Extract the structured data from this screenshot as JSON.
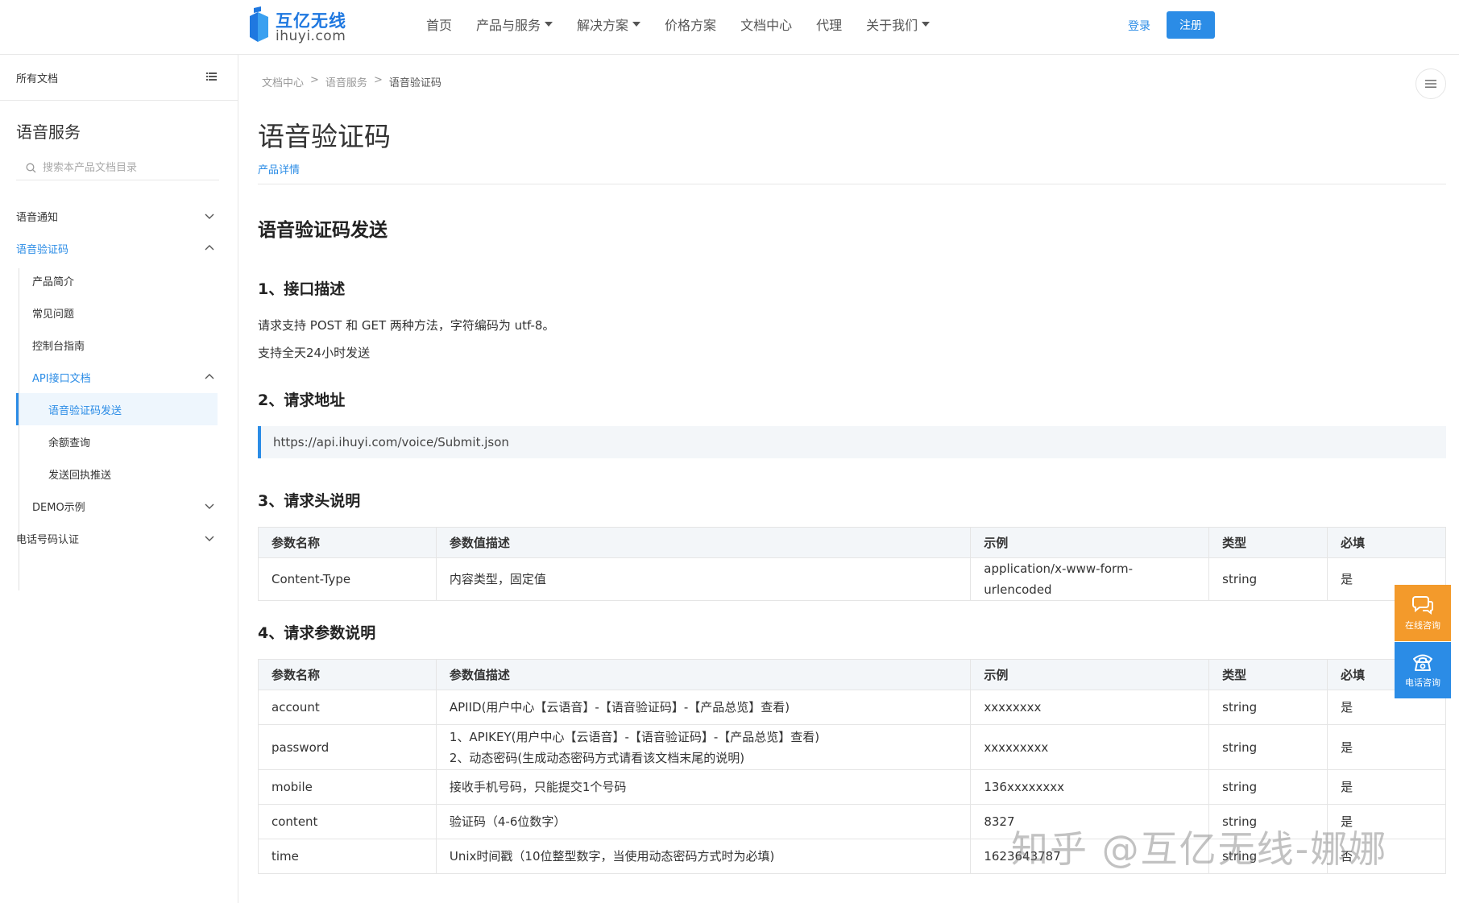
{
  "header": {
    "brand_cn": "互亿无线",
    "brand_en": "ihuyi.com",
    "nav": [
      {
        "label": "首页",
        "dropdown": false
      },
      {
        "label": "产品与服务",
        "dropdown": true
      },
      {
        "label": "解决方案",
        "dropdown": true
      },
      {
        "label": "价格方案",
        "dropdown": false
      },
      {
        "label": "文档中心",
        "dropdown": false
      },
      {
        "label": "代理",
        "dropdown": false
      },
      {
        "label": "关于我们",
        "dropdown": true
      }
    ],
    "login": "登录",
    "register": "注册"
  },
  "sidebar": {
    "all_docs": "所有文档",
    "title": "语音服务",
    "search_placeholder": "搜索本产品文档目录",
    "items": [
      {
        "label": "语音通知",
        "level": 0,
        "state": "collapsed"
      },
      {
        "label": "语音验证码",
        "level": 0,
        "state": "expanded",
        "active": true
      },
      {
        "label": "产品简介",
        "level": 1
      },
      {
        "label": "常见问题",
        "level": 1
      },
      {
        "label": "控制台指南",
        "level": 1
      },
      {
        "label": "API接口文档",
        "level": 1,
        "state": "expanded",
        "active": true
      },
      {
        "label": "语音验证码发送",
        "level": 2,
        "selected": true
      },
      {
        "label": "余额查询",
        "level": 2
      },
      {
        "label": "发送回执推送",
        "level": 2
      },
      {
        "label": "DEMO示例",
        "level": 1,
        "state": "collapsed"
      },
      {
        "label": "电话号码认证",
        "level": 0,
        "state": "collapsed"
      }
    ]
  },
  "breadcrumb": [
    "文档中心",
    "语音服务",
    "语音验证码"
  ],
  "breadcrumb_sep": ">",
  "page_title": "语音验证码",
  "product_detail": "产品详情",
  "section_title": "语音验证码发送",
  "s1": {
    "heading": "1、接口描述",
    "lines": [
      "请求支持 POST 和 GET 两种方法，字符编码为 utf-8。",
      "支持全天24小时发送"
    ]
  },
  "s2": {
    "heading": "2、请求地址",
    "url": "https://api.ihuyi.com/voice/Submit.json"
  },
  "s3": {
    "heading": "3、请求头说明",
    "columns": [
      "参数名称",
      "参数值描述",
      "示例",
      "类型",
      "必填"
    ],
    "rows": [
      [
        "Content-Type",
        "内容类型，固定值",
        "application/x-www-form-urlencoded",
        "string",
        "是"
      ]
    ]
  },
  "s4": {
    "heading": "4、请求参数说明",
    "columns": [
      "参数名称",
      "参数值描述",
      "示例",
      "类型",
      "必填"
    ],
    "rows": [
      {
        "name": "account",
        "desc": [
          "APIID(用户中心【云语音】-【语音验证码】-【产品总览】查看)"
        ],
        "example": "xxxxxxxx",
        "type": "string",
        "required": "是"
      },
      {
        "name": "password",
        "desc": [
          "1、APIKEY(用户中心【云语音】-【语音验证码】-【产品总览】查看)",
          "2、动态密码(生成动态密码方式请看该文档末尾的说明)"
        ],
        "example": "xxxxxxxxx",
        "type": "string",
        "required": "是"
      },
      {
        "name": "mobile",
        "desc": [
          "接收手机号码，只能提交1个号码"
        ],
        "example": "136xxxxxxxx",
        "type": "string",
        "required": "是"
      },
      {
        "name": "content",
        "desc": [
          "验证码（4-6位数字）"
        ],
        "example": "8327",
        "type": "string",
        "required": "是"
      },
      {
        "name": "time",
        "desc": [
          "Unix时间戳（10位整型数字，当使用动态密码方式时为必填)"
        ],
        "example": "1623643787",
        "type": "string",
        "required": "否"
      }
    ]
  },
  "float": {
    "online": "在线咨询",
    "phone": "电话咨询"
  },
  "watermark": "知乎 @互亿无线-娜娜",
  "colors": {
    "accent": "#2b8ce6",
    "orange": "#f39a2b"
  }
}
